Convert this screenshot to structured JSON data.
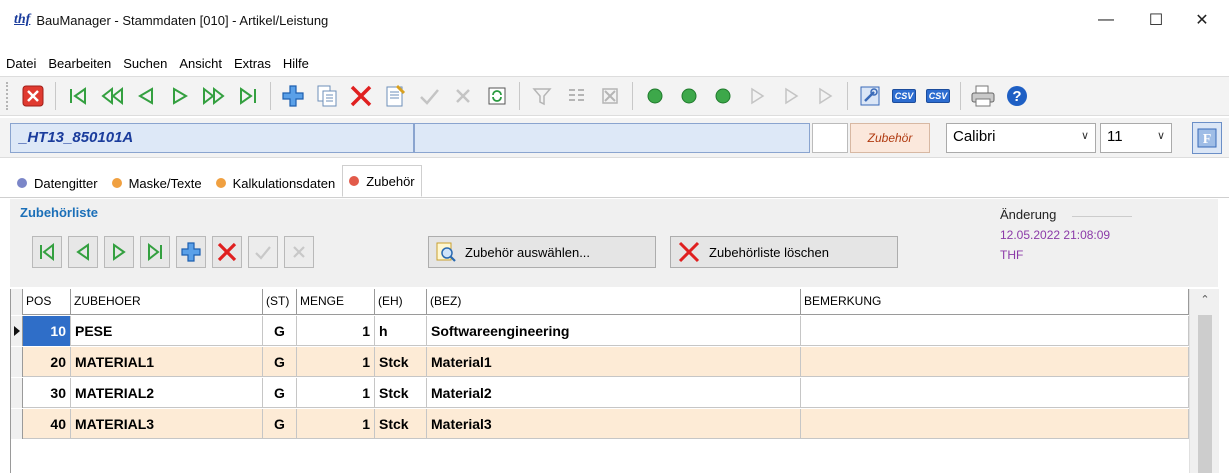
{
  "window": {
    "logo": "thf",
    "title": "BauManager - Stammdaten [010] - Artikel/Leistung",
    "minimize": "—",
    "maximize": "☐",
    "close": "✕"
  },
  "menu": [
    "Datei",
    "Bearbeiten",
    "Suchen",
    "Ansicht",
    "Extras",
    "Hilfe"
  ],
  "toolbar": {
    "csv1": "CSV",
    "csv2": "CSV"
  },
  "record": {
    "code": "_HT13_850101A",
    "description": "",
    "type_label": "Zubehör",
    "font": "Calibri",
    "font_size": "11"
  },
  "tabs": [
    {
      "label": "Datengitter",
      "color": "#7b86c8"
    },
    {
      "label": "Maske/Texte",
      "color": "#f0a040"
    },
    {
      "label": "Kalkulationsdaten",
      "color": "#f0a040"
    },
    {
      "label": "Zubehör",
      "color": "#e25a4a"
    }
  ],
  "panel": {
    "title": "Zubehörliste",
    "select_button": "Zubehör auswählen...",
    "clear_button": "Zubehörliste löschen",
    "change_title": "Änderung",
    "change_date": "12.05.2022 21:08:09",
    "change_user": "THF"
  },
  "grid": {
    "columns": [
      "POS",
      "ZUBEHOER",
      "(ST)",
      "MENGE",
      "(EH)",
      "(BEZ)",
      "BEMERKUNG"
    ],
    "rows": [
      {
        "pos": "10",
        "zubehoer": "PESE",
        "st": "G",
        "menge": "1",
        "eh": "h",
        "bez": "Softwareengineering",
        "bemerkung": ""
      },
      {
        "pos": "20",
        "zubehoer": "MATERIAL1",
        "st": "G",
        "menge": "1",
        "eh": "Stck",
        "bez": "Material1",
        "bemerkung": ""
      },
      {
        "pos": "30",
        "zubehoer": "MATERIAL2",
        "st": "G",
        "menge": "1",
        "eh": "Stck",
        "bez": "Material2",
        "bemerkung": ""
      },
      {
        "pos": "40",
        "zubehoer": "MATERIAL3",
        "st": "G",
        "menge": "1",
        "eh": "Stck",
        "bez": "Material3",
        "bemerkung": ""
      }
    ]
  },
  "colors": {
    "accent_blue": "#1b6fb8",
    "row_alt": "#fdebd6",
    "selected_cell": "#2f6ec8",
    "change_text": "#8b3aa8"
  }
}
